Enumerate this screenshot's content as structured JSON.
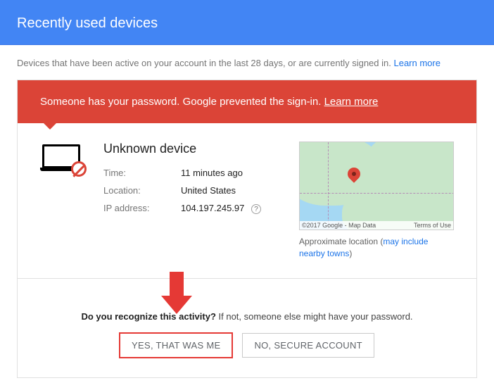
{
  "header": {
    "title": "Recently used devices"
  },
  "subtext": {
    "text": "Devices that have been active on your account in the last 28 days, or are currently signed in.  ",
    "link": "Learn more"
  },
  "alert": {
    "text": "Someone has your password. Google prevented the sign-in.  ",
    "link": "Learn more"
  },
  "device": {
    "title": "Unknown device",
    "labels": {
      "time": "Time:",
      "location": "Location:",
      "ip": "IP address:"
    },
    "values": {
      "time": "11 minutes ago",
      "location": "United States",
      "ip": "104.197.245.97"
    }
  },
  "map": {
    "attribution": "©2017 Google - Map Data",
    "terms": "Terms of Use",
    "caption_prefix": "Approximate location (",
    "caption_link": "may include nearby towns",
    "caption_suffix": ")"
  },
  "prompt": {
    "question": "Do you recognize this activity?",
    "warning": " If not, someone else might have your password.",
    "yes": "Yes, that was me",
    "no": "No, secure account"
  }
}
